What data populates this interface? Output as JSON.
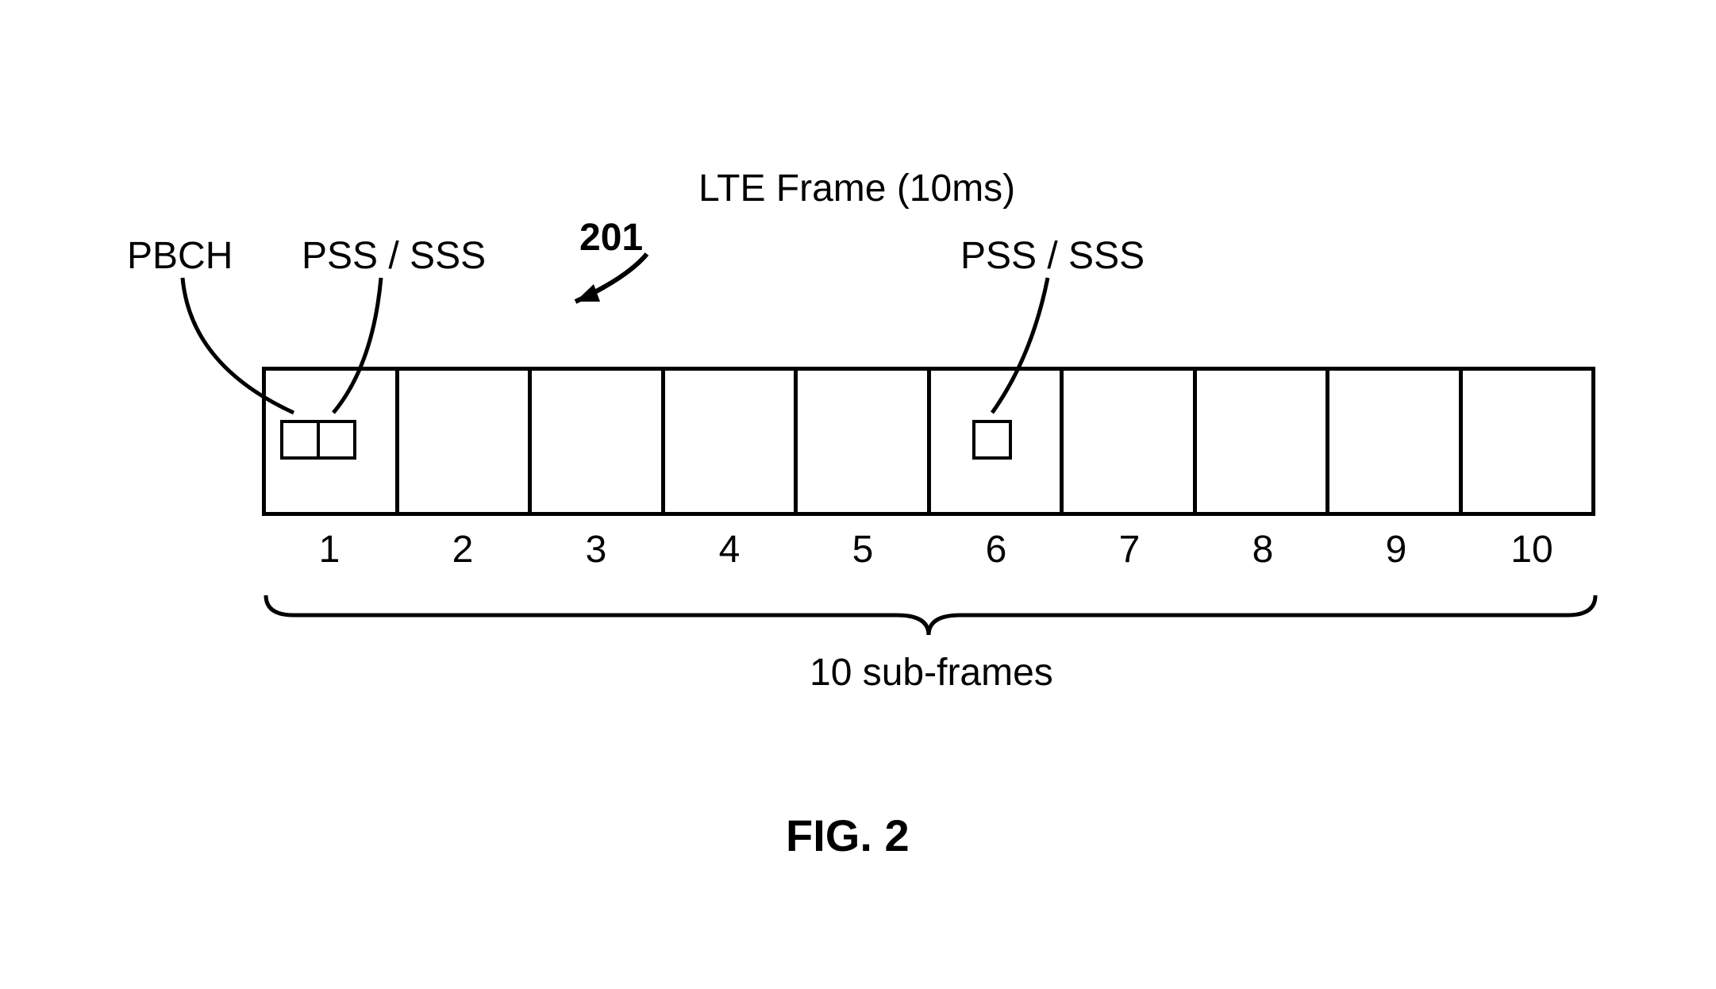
{
  "title": "LTE Frame (10ms)",
  "ref": "201",
  "labels": {
    "pbch": "PBCH",
    "pss_sss_left": "PSS / SSS",
    "pss_sss_right": "PSS / SSS"
  },
  "brace_caption": "10 sub-frames",
  "figure_caption": "FIG. 2",
  "subframe_numbers": [
    "1",
    "2",
    "3",
    "4",
    "5",
    "6",
    "7",
    "8",
    "9",
    "10"
  ]
}
